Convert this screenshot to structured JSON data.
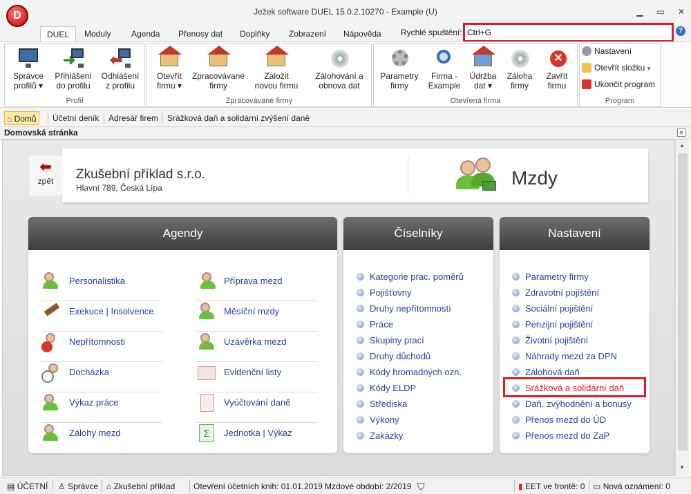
{
  "window": {
    "title": "Ježek software DUEL 15.0.2.10270 - Example (U)",
    "logo_letter": "D"
  },
  "menu": {
    "tabs": [
      "DUEL",
      "Moduly",
      "Agenda",
      "Přenosy dat",
      "Doplňky",
      "Zobrazení",
      "Nápověda"
    ],
    "active": "DUEL"
  },
  "quick_launch": {
    "label": "Rychlé spuštění:",
    "value": "Ctrl+G"
  },
  "ribbon": {
    "profil": {
      "label": "Profil",
      "buttons": [
        [
          "Správce",
          "profilů ▾"
        ],
        [
          "Přihlášení",
          "do profilu"
        ],
        [
          "Odhlášení",
          "z profilu"
        ]
      ]
    },
    "zpracovavane": {
      "label": "Zpracovávané firmy",
      "buttons": [
        [
          "Otevřít",
          "firmu ▾"
        ],
        [
          "Zpracovávané",
          "firmy"
        ],
        [
          "Založit",
          "novou firmu"
        ],
        [
          "Zálohování a",
          "obnova dat"
        ]
      ]
    },
    "otevrena": {
      "label": "Otevřená firma",
      "buttons": [
        [
          "Parametry",
          "firmy"
        ],
        [
          "Firma -",
          "Example"
        ],
        [
          "Údržba",
          "dat ▾"
        ],
        [
          "Záloha",
          "firmy"
        ],
        [
          "Zavřít",
          "firmu"
        ]
      ]
    },
    "program": {
      "label": "Program",
      "items": [
        "Nastavení",
        "Otevřít složku",
        "Ukončit program"
      ]
    }
  },
  "navtabs": [
    "Domů",
    "Účetní deník",
    "Adresář firem",
    "Srážková daň a solidární zvýšení daně"
  ],
  "panel_title": "Domovská stránka",
  "back_label": "zpět",
  "company": {
    "name": "Zkušební příklad s.r.o.",
    "address": "Hlavní 789, Česká Lípa"
  },
  "module": "Mzdy",
  "agendy": {
    "title": "Agendy",
    "left": [
      "Personalistika",
      "Exekuce | Insolvence",
      "Nepřítomnosti",
      "Docházka",
      "Výkaz práce",
      "Zálohy mezd"
    ],
    "right": [
      "Příprava mezd",
      "Měsíční mzdy",
      "Uzávěrka mezd",
      "Evidenční listy",
      "Vyúčtování daně",
      "Jednotka | Výkaz"
    ]
  },
  "ciselniky": {
    "title": "Číselníky",
    "items": [
      "Kategorie prac. poměrů",
      "Pojišťovny",
      "Druhy nepřítomností",
      "Práce",
      "Skupiny prací",
      "Druhy důchodů",
      "Kódy hromadných ozn.",
      "Kódy ELDP",
      "Střediska",
      "Výkony",
      "Zakázky"
    ]
  },
  "nastaveni": {
    "title": "Nastavení",
    "items": [
      "Parametry firmy",
      "Zdravotní pojištění",
      "Sociální pojištění",
      "Penzijní pojištění",
      "Životní pojištění",
      "Náhrady mezd za DPN",
      "Zálohová daň",
      "Srážková a solidární daň",
      "Daň. zvýhodnění a bonusy",
      "Přenos mezd do ÚD",
      "Přenos mezd do ZaP"
    ],
    "highlighted": "Srážková a solidární daň"
  },
  "status": {
    "ucetni": "ÚČETNÍ",
    "user": "Správce",
    "firm": "Zkušební příklad",
    "open_books": "Otevření účetních knih: 01.01.2019",
    "period": "Mzdové období: 2/2019",
    "eet": "EET ve frontě: 0",
    "notices": "Nová oznámení: 0"
  },
  "colors": {
    "accent_red": "#e21b23",
    "link_blue": "#2540a0",
    "header_dark": "#4a4a4a"
  }
}
